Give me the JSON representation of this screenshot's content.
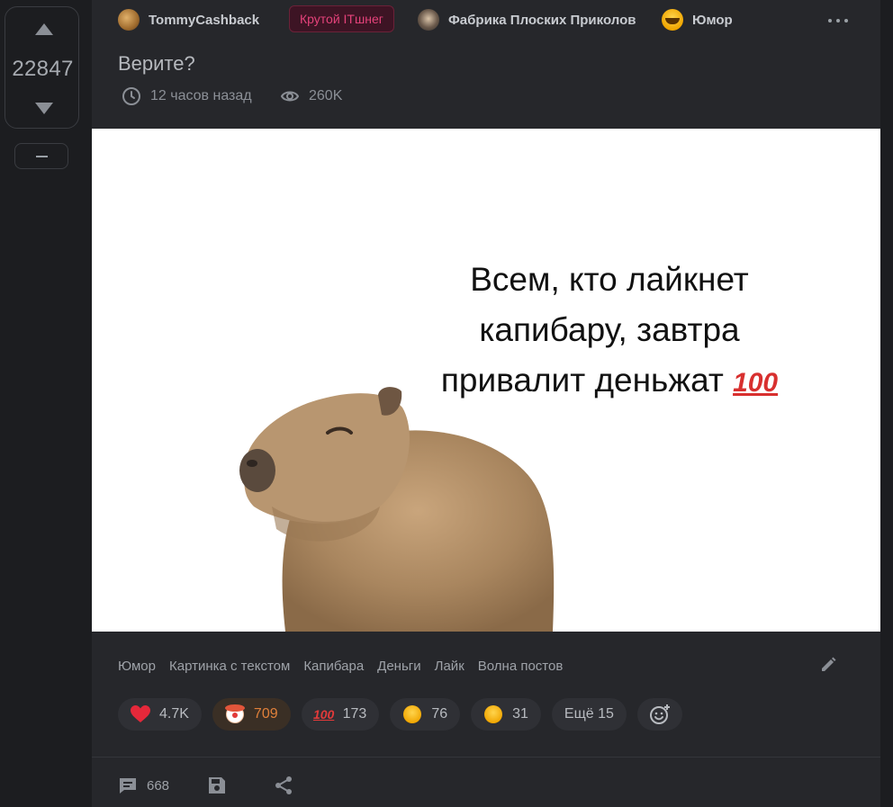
{
  "rating": {
    "value": "22847"
  },
  "header": {
    "author": "TommyCashback",
    "badge": "Крутой ITшнег",
    "community": "Фабрика Плоских Приколов",
    "category": "Юмор"
  },
  "post": {
    "title": "Верите?",
    "time": "12 часов назад",
    "views": "260K",
    "image_text": {
      "line1": "Всем, кто лайкнет",
      "line2": "капибару, завтра",
      "line3": "привалит деньжат",
      "emoji": "100"
    }
  },
  "tags": [
    "Юмор",
    "Картинка с текстом",
    "Капибара",
    "Деньги",
    "Лайк",
    "Волна постов"
  ],
  "reactions": [
    {
      "icon": "heart-icon",
      "count": "4.7K"
    },
    {
      "icon": "clown-icon",
      "count": "709"
    },
    {
      "icon": "hundred-icon",
      "count": "173"
    },
    {
      "icon": "grin-icon",
      "count": "76"
    },
    {
      "icon": "thinking-icon",
      "count": "31"
    }
  ],
  "more_reactions": "Ещё 15",
  "footer": {
    "comments": "668"
  },
  "colors": {
    "background": "#1c1d20",
    "card": "#26272b",
    "badge_text": "#e4427a",
    "active_reaction": "#e0803a"
  }
}
